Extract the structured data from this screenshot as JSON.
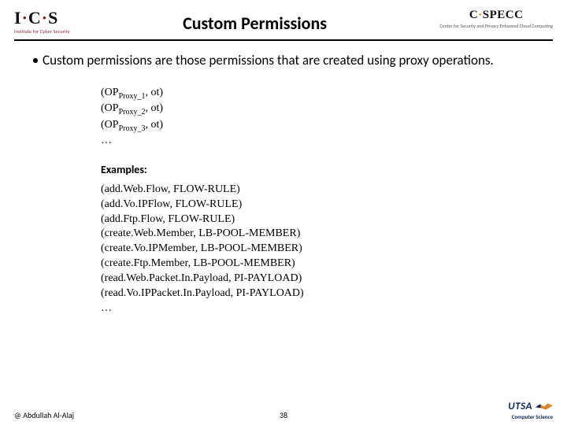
{
  "header": {
    "left_logo": {
      "text": "I·C·S",
      "sub": "Institute for Cyber Security"
    },
    "title": "Custom Permissions",
    "right_logo": {
      "text": "C·SPECC",
      "sub": "Center for Security and Privacy Enhanced Cloud Computing"
    }
  },
  "bullet": "Custom permissions are those permissions that are created using proxy operations.",
  "proxies": [
    {
      "op": "OP",
      "sub": "Proxy_1",
      "rest": ", ot)"
    },
    {
      "op": "OP",
      "sub": "Proxy_2",
      "rest": ", ot)"
    },
    {
      "op": "OP",
      "sub": "Proxy_3",
      "rest": ", ot)"
    }
  ],
  "proxy_ellipsis": "…",
  "examples_label": "Examples:",
  "examples": [
    "(add.Web.Flow, FLOW-RULE)",
    "(add.Vo.IPFlow, FLOW-RULE)",
    "(add.Ftp.Flow, FLOW-RULE)",
    "(create.Web.Member, LB-POOL-MEMBER)",
    "(create.Vo.IPMember, LB-POOL-MEMBER)",
    "(create.Ftp.Member, LB-POOL-MEMBER)",
    "(read.Web.Packet.In.Payload, PI-PAYLOAD)",
    "(read.Vo.IPPacket.In.Payload, PI-PAYLOAD)",
    "…"
  ],
  "footer": {
    "copyright": "@ Abdullah Al-Alaj",
    "page": "38",
    "utsa": "UTSA",
    "utsa_sub": "Computer Science"
  }
}
